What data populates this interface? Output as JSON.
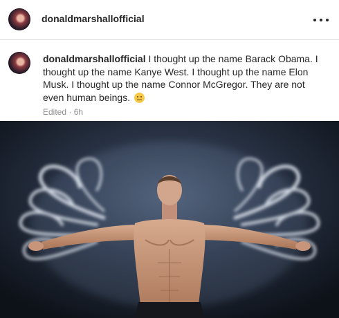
{
  "post": {
    "username": "donaldmarshallofficial",
    "caption": "I thought up the name Barack Obama. I thought up the name Kanye West. I thought up the name Elon Musk. I thought up the name Connor McGregor. They are not even human beings.",
    "emoji_icon": "neutral-face-icon",
    "meta": "Edited · 6h",
    "image_icon": "shirtless-man-with-glowing-smoke-wings"
  }
}
